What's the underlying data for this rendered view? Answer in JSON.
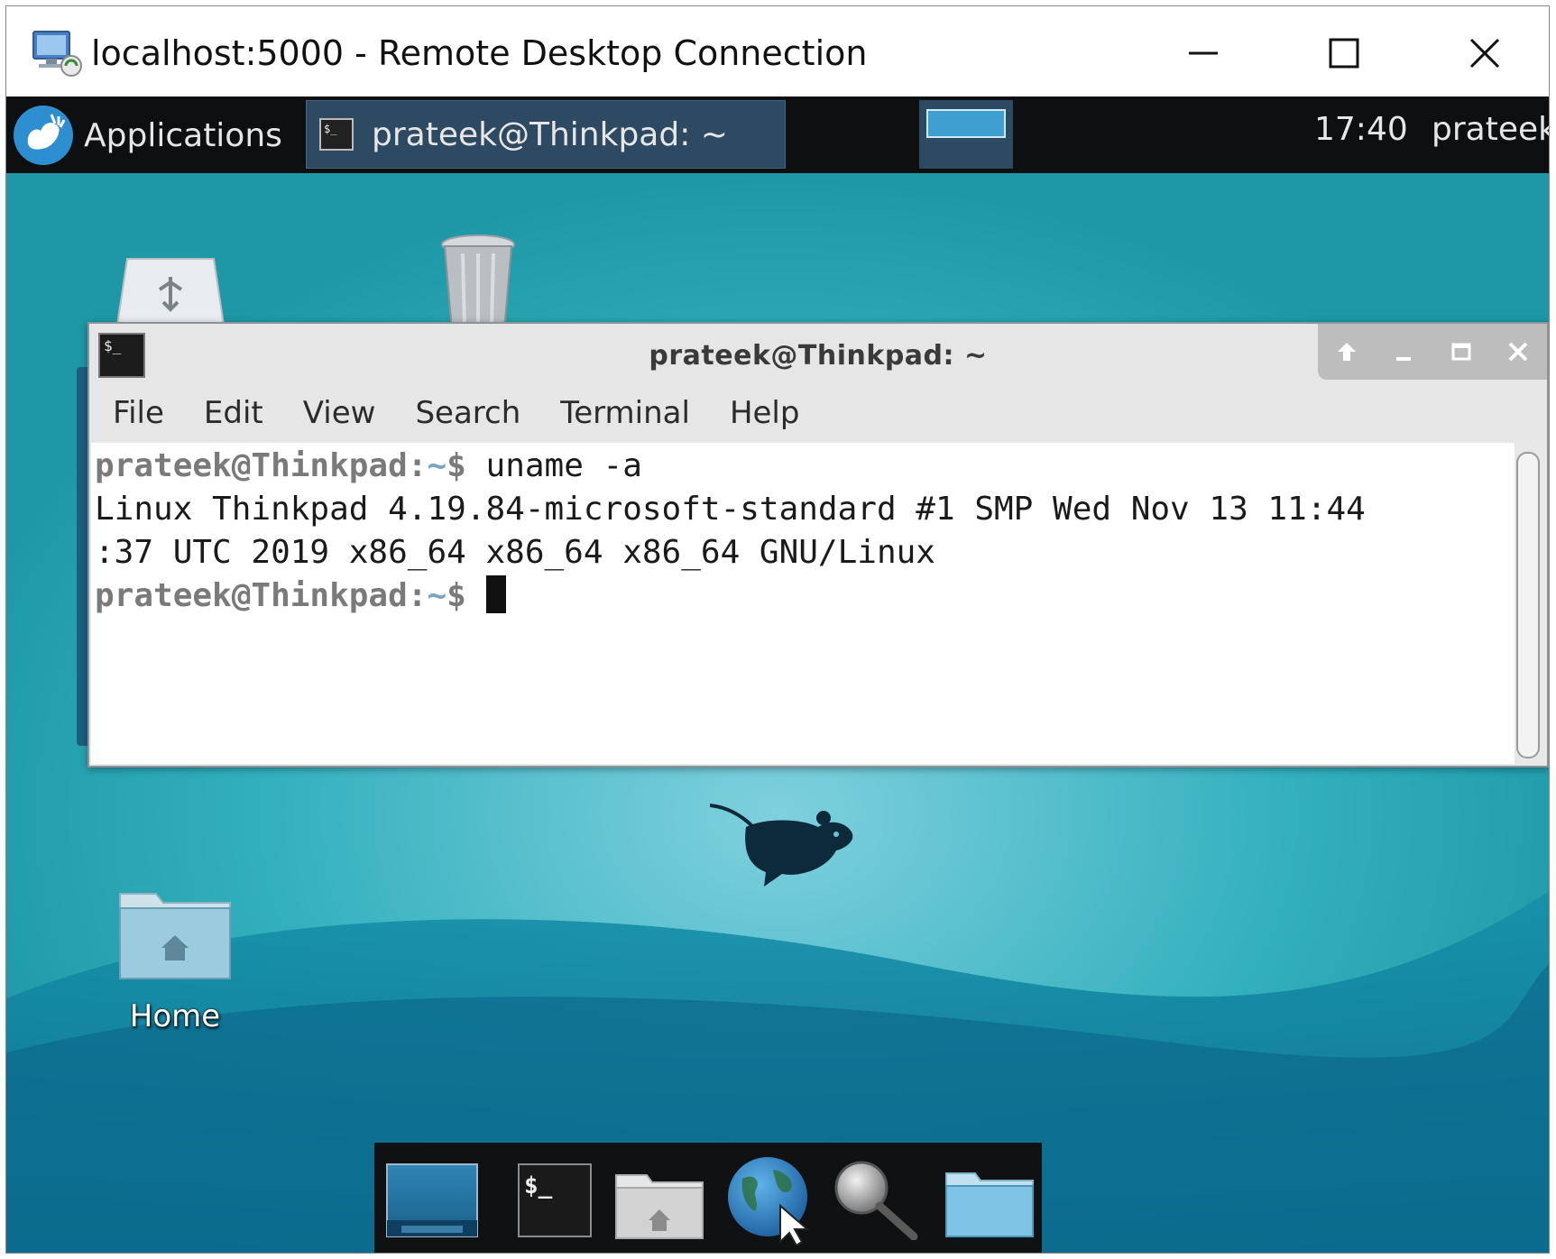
{
  "rdp": {
    "title": "localhost:5000 - Remote Desktop Connection",
    "controls": {
      "minimize": "minimize-icon",
      "maximize": "maximize-icon",
      "close": "close-icon"
    }
  },
  "panel": {
    "applications_label": "Applications",
    "task_label": "prateek@Thinkpad: ~",
    "clock": "17:40",
    "user": "prateek"
  },
  "desktop": {
    "home_label": "Home",
    "background_color": "#2aa9b3"
  },
  "terminal": {
    "title": "prateek@Thinkpad: ~",
    "menu": [
      "File",
      "Edit",
      "View",
      "Search",
      "Terminal",
      "Help"
    ],
    "prompt_user": "prateek@Thinkpad",
    "prompt_colon": ":",
    "prompt_path": "~",
    "prompt_symbol": "$ ",
    "command": "uname -a",
    "output_line1": "Linux Thinkpad 4.19.84-microsoft-standard #1 SMP Wed Nov 13 11:44",
    "output_line2": ":37 UTC 2019 x86_64 x86_64 x86_64 GNU/Linux"
  },
  "dock": {
    "items": [
      "show-desktop-icon",
      "terminal-icon",
      "file-manager-icon",
      "web-browser-icon",
      "search-icon",
      "folder-icon"
    ]
  }
}
